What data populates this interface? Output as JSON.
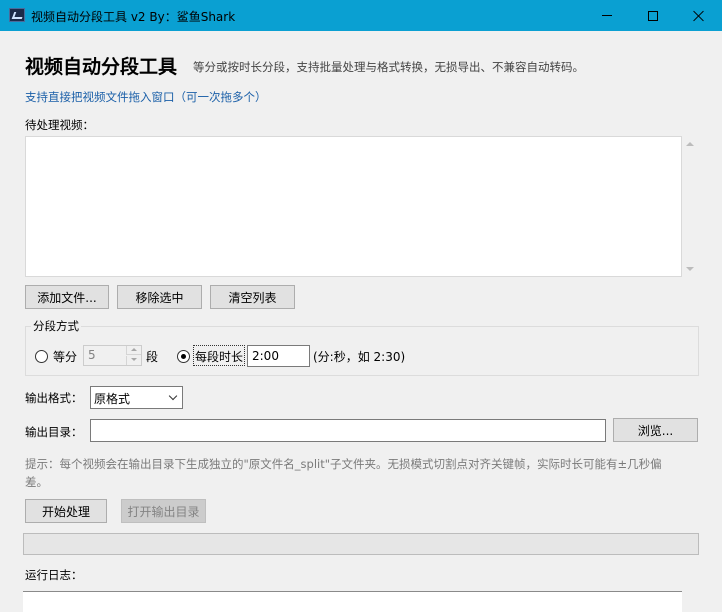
{
  "window": {
    "title": "视频自动分段工具 v2   By：鲨鱼Shark",
    "icon": "video-app-icon"
  },
  "header": {
    "title": "视频自动分段工具",
    "subtitle": "等分或按时长分段，支持批量处理与格式转换，无损导出、不兼容自动转码。",
    "drag_hint": "支持直接把视频文件拖入窗口（可一次拖多个）"
  },
  "file_list": {
    "label": "待处理视频：",
    "items": []
  },
  "list_buttons": {
    "add": "添加文件...",
    "remove": "移除选中",
    "clear": "清空列表"
  },
  "split_mode": {
    "group_title": "分段方式",
    "equal_label": "等分",
    "equal_count": "5",
    "equal_unit": "段",
    "duration_label": "每段时长",
    "duration_value": "2:00",
    "duration_hint": "(分:秒，如 2:30)",
    "selected": "duration"
  },
  "output": {
    "format_label": "输出格式：",
    "format_value": "原格式",
    "dir_label": "输出目录：",
    "dir_value": "",
    "browse": "浏览..."
  },
  "tip": "提示：每个视频会在输出目录下生成独立的\"原文件名_split\"子文件夹。无损模式切割点对齐关键帧，实际时长可能有±几秒偏差。",
  "actions": {
    "start": "开始处理",
    "open_output": "打开输出目录"
  },
  "progress": {
    "value": 0
  },
  "log": {
    "label": "运行日志："
  }
}
